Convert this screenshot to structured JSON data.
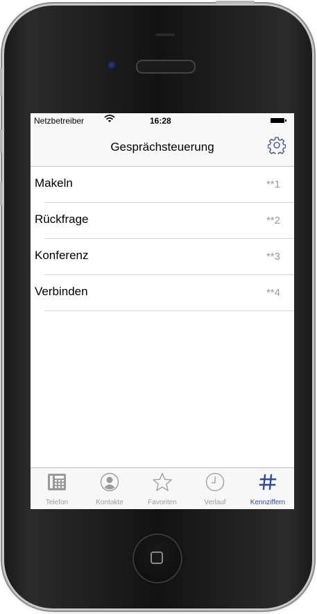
{
  "status_bar": {
    "carrier": "Netzbetreiber",
    "wifi_icon": "wifi-icon",
    "time": "16:28",
    "battery_icon": "battery-full-icon"
  },
  "nav_bar": {
    "title": "Gesprächsteuerung",
    "settings_icon": "gear-icon"
  },
  "list": {
    "items": [
      {
        "label": "Makeln",
        "code": "**1"
      },
      {
        "label": "Rückfrage",
        "code": "**2"
      },
      {
        "label": "Konferenz",
        "code": "**3"
      },
      {
        "label": "Verbinden",
        "code": "**4"
      }
    ]
  },
  "tab_bar": {
    "tabs": [
      {
        "label": "Telefon",
        "icon": "keypad-icon",
        "active": false
      },
      {
        "label": "Kontakte",
        "icon": "contact-icon",
        "active": false
      },
      {
        "label": "Favoriten",
        "icon": "star-icon",
        "active": false
      },
      {
        "label": "Verlauf",
        "icon": "clock-icon",
        "active": false
      },
      {
        "label": "Kennziffern",
        "icon": "hash-icon",
        "active": true
      }
    ]
  },
  "colors": {
    "accent": "#2d4aa1",
    "inactive": "#9a9a9a"
  }
}
